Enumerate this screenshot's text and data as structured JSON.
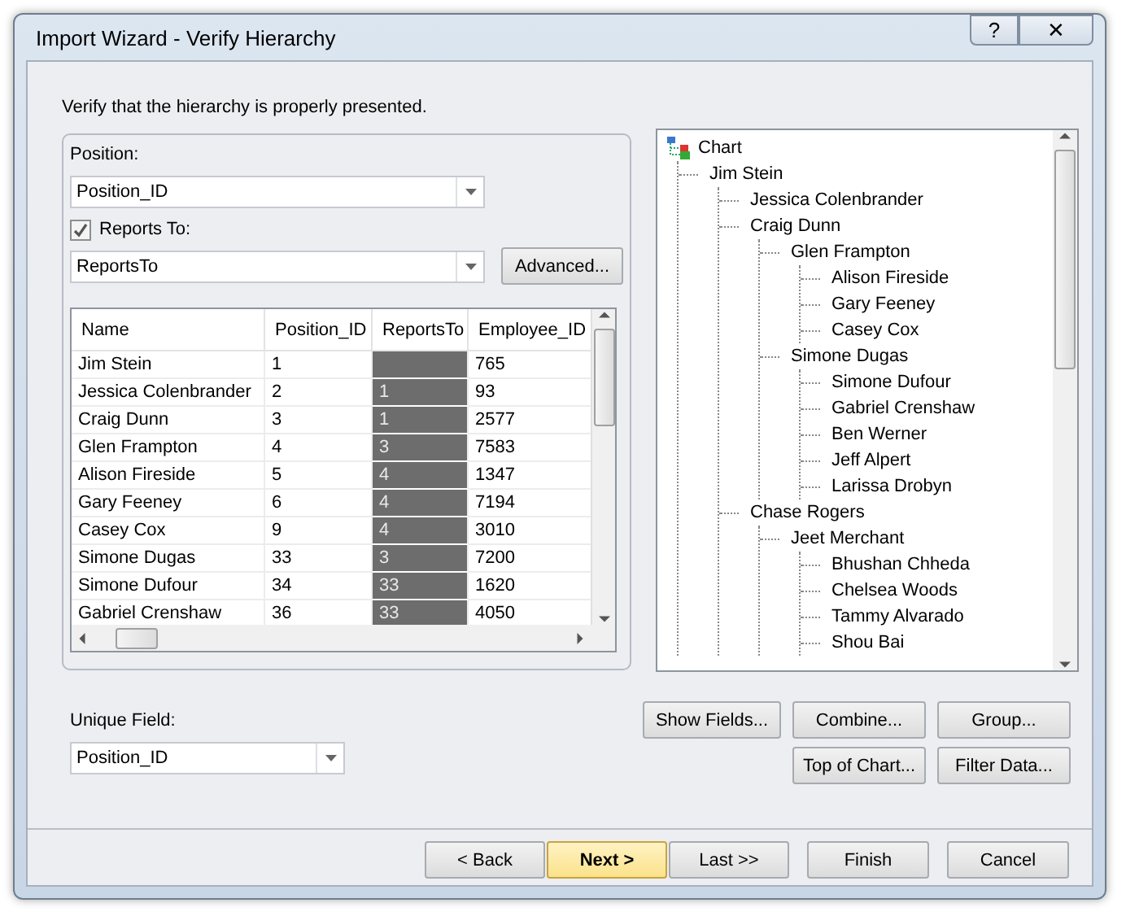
{
  "window": {
    "title": "Import Wizard - Verify Hierarchy",
    "help": "?",
    "close": "✕"
  },
  "instruction": "Verify that the hierarchy is properly presented.",
  "position": {
    "label": "Position:",
    "value": "Position_ID"
  },
  "reports_to": {
    "label": "Reports To:",
    "checked": true,
    "value": "ReportsTo"
  },
  "advanced_button": "Advanced...",
  "table": {
    "columns": [
      "Name",
      "Position_ID",
      "ReportsTo",
      "Employee_ID"
    ],
    "rows": [
      [
        "Jim Stein",
        "1",
        "",
        "765"
      ],
      [
        "Jessica Colenbrander",
        "2",
        "1",
        "93"
      ],
      [
        "Craig Dunn",
        "3",
        "1",
        "2577"
      ],
      [
        "Glen Frampton",
        "4",
        "3",
        "7583"
      ],
      [
        "Alison Fireside",
        "5",
        "4",
        "1347"
      ],
      [
        "Gary Feeney",
        "6",
        "4",
        "7194"
      ],
      [
        "Casey Cox",
        "9",
        "4",
        "3010"
      ],
      [
        "Simone Dugas",
        "33",
        "3",
        "7200"
      ],
      [
        "Simone Dufour",
        "34",
        "33",
        "1620"
      ],
      [
        "Gabriel Crenshaw",
        "36",
        "33",
        "4050"
      ]
    ]
  },
  "tree": {
    "label": "Chart",
    "children": [
      {
        "label": "Jim Stein",
        "children": [
          {
            "label": "Jessica Colenbrander"
          },
          {
            "label": "Craig Dunn",
            "children": [
              {
                "label": "Glen Frampton",
                "children": [
                  {
                    "label": "Alison Fireside"
                  },
                  {
                    "label": "Gary Feeney"
                  },
                  {
                    "label": "Casey Cox"
                  }
                ]
              },
              {
                "label": "Simone Dugas",
                "children": [
                  {
                    "label": "Simone Dufour"
                  },
                  {
                    "label": "Gabriel Crenshaw"
                  },
                  {
                    "label": "Ben Werner"
                  },
                  {
                    "label": "Jeff Alpert"
                  },
                  {
                    "label": "Larissa Drobyn"
                  }
                ]
              }
            ]
          },
          {
            "label": "Chase Rogers",
            "children": [
              {
                "label": "Jeet Merchant",
                "children": [
                  {
                    "label": "Bhushan Chheda"
                  },
                  {
                    "label": "Chelsea Woods"
                  },
                  {
                    "label": "Tammy Alvarado"
                  },
                  {
                    "label": "Shou Bai"
                  }
                ]
              }
            ]
          }
        ]
      }
    ]
  },
  "unique_field": {
    "label": "Unique Field:",
    "value": "Position_ID"
  },
  "tool_buttons": [
    [
      "Show Fields...",
      "Combine...",
      "Group..."
    ],
    [
      "Top of Chart...",
      "Filter Data..."
    ]
  ],
  "nav_buttons": [
    {
      "label": "< Back",
      "default": false
    },
    {
      "label": "Next >",
      "default": true
    },
    {
      "label": "Last >>",
      "default": false
    }
  ],
  "end_buttons": [
    "Finish",
    "Cancel"
  ]
}
